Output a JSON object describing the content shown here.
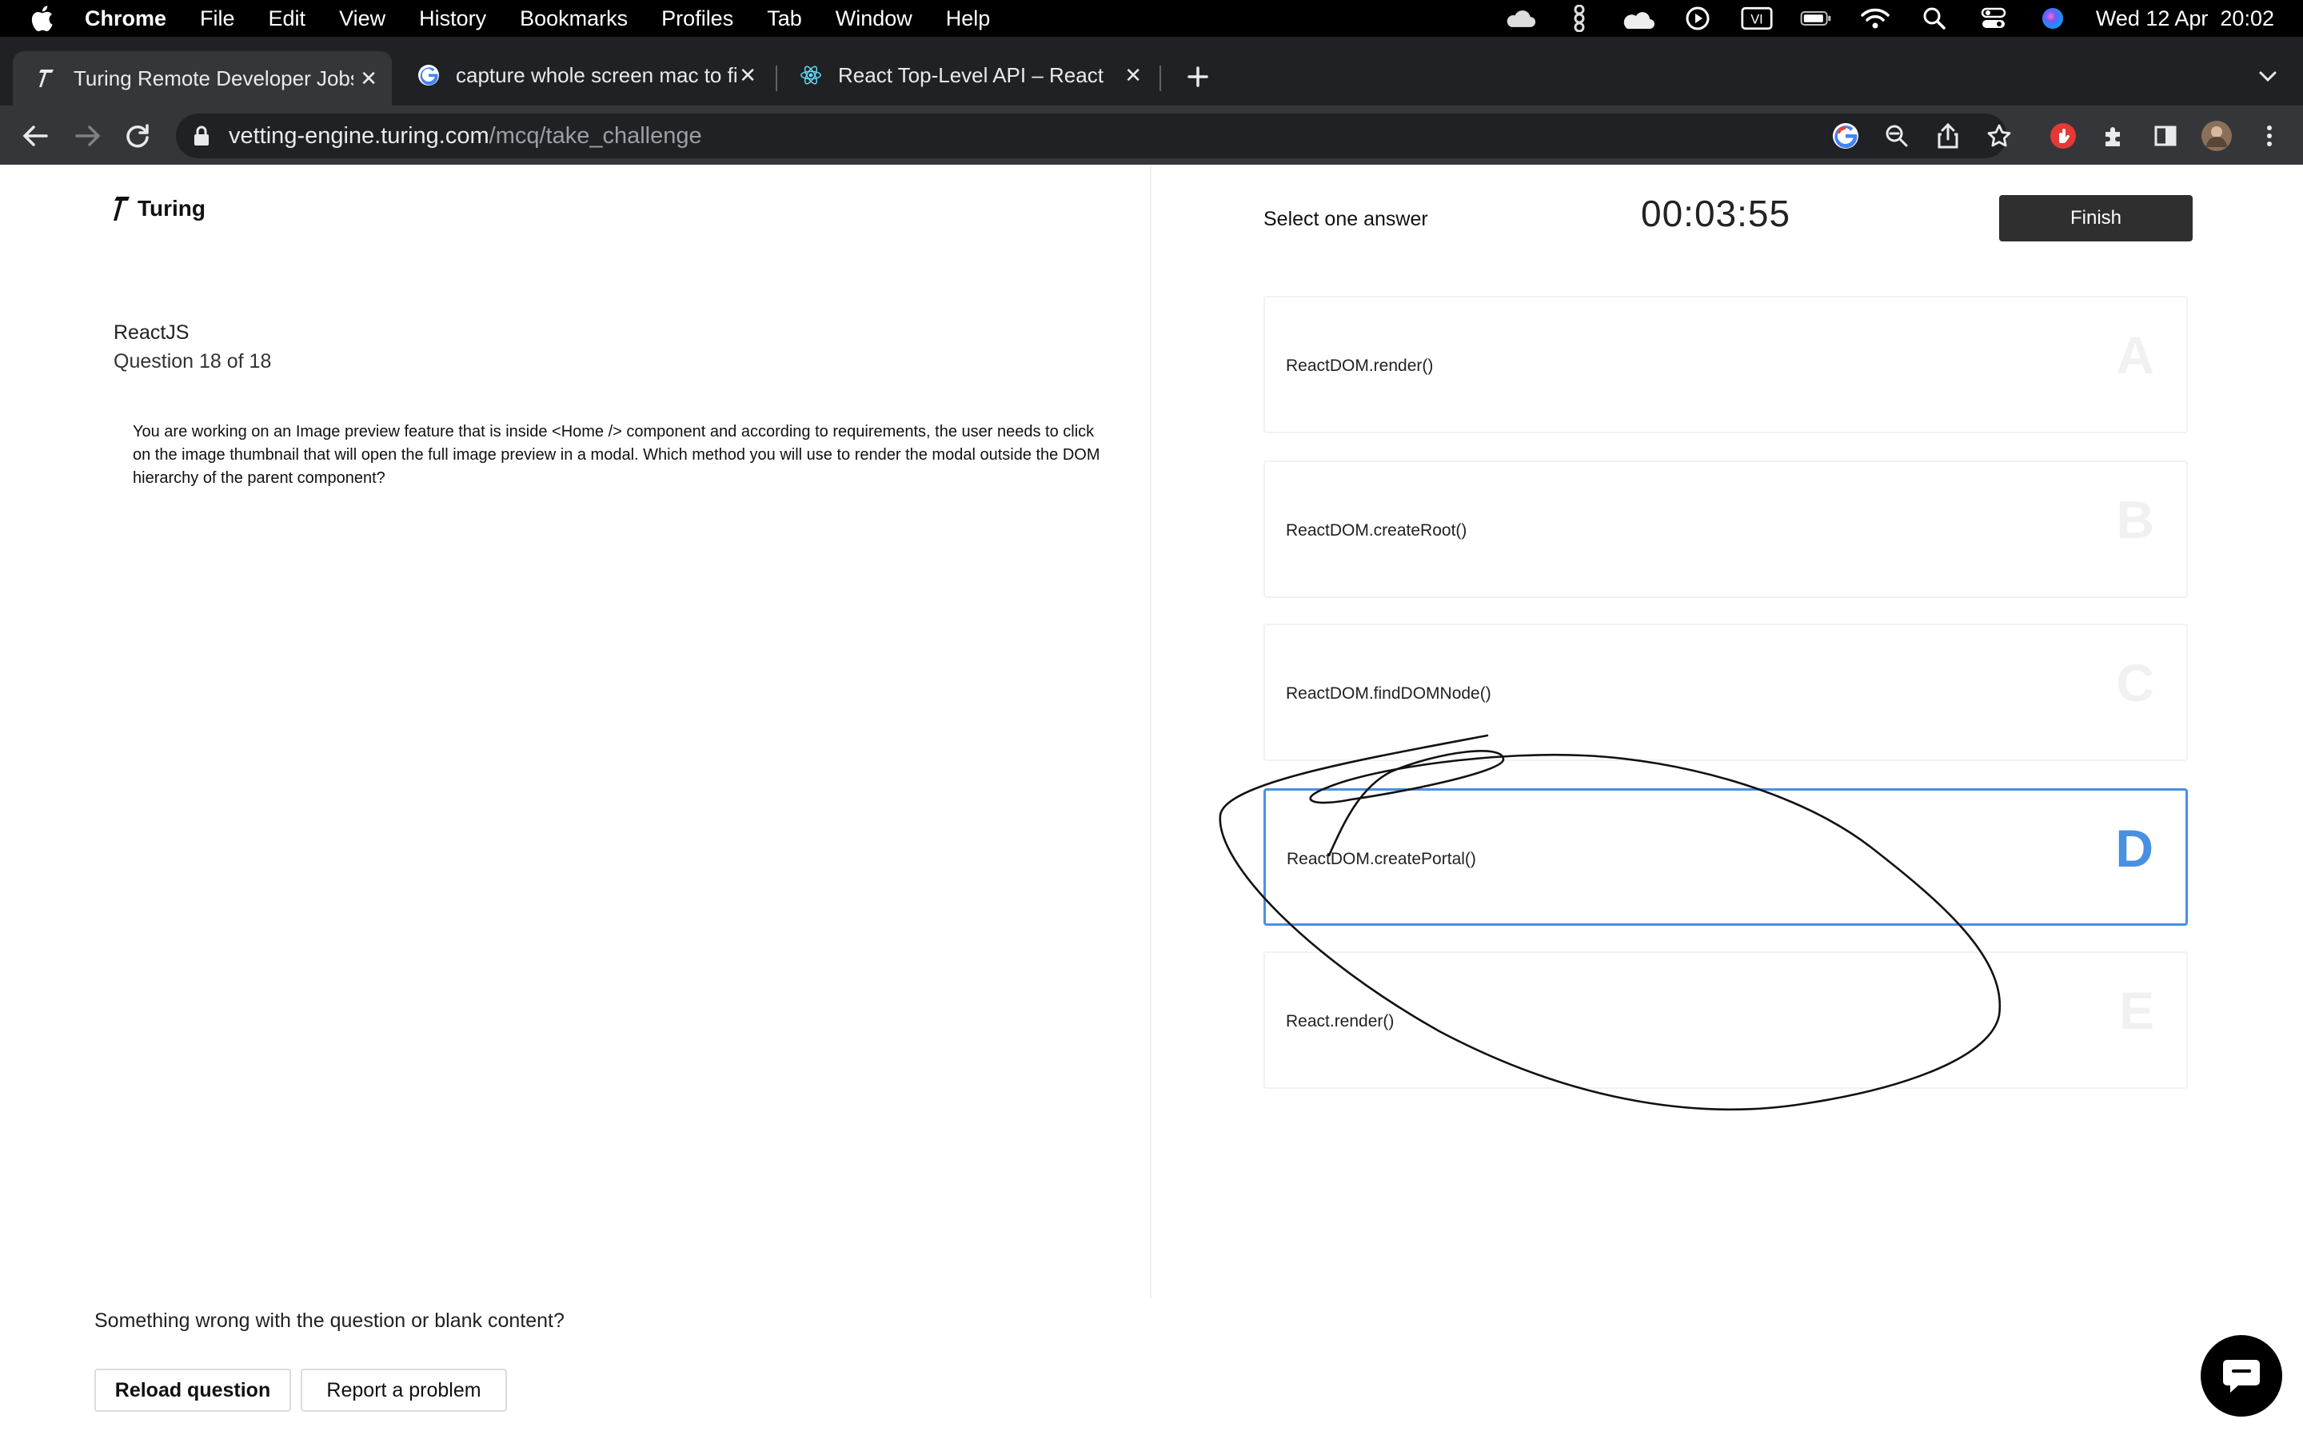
{
  "menubar": {
    "app": "Chrome",
    "items": [
      "File",
      "Edit",
      "View",
      "History",
      "Bookmarks",
      "Profiles",
      "Tab",
      "Window",
      "Help"
    ],
    "status_icons": [
      "cloud-icon",
      "figure-icon",
      "cloud-icon",
      "play-icon",
      "vi-icon",
      "battery-icon",
      "wifi-icon",
      "search-icon",
      "control-center-icon",
      "siri-icon"
    ],
    "vi_label": "VI",
    "datetime": "Wed 12 Apr  20:02"
  },
  "tabs": [
    {
      "title": "Turing Remote Developer Jobs",
      "icon": "turing-icon",
      "active": true
    },
    {
      "title": "capture whole screen mac to fi",
      "icon": "google-icon",
      "active": false
    },
    {
      "title": "React Top-Level API – React",
      "icon": "react-icon",
      "active": false
    }
  ],
  "toolbar": {
    "url_host": "vetting-engine.turing.com",
    "url_path": "/mcq/take_challenge"
  },
  "page": {
    "logo_text": "Turing",
    "subject": "ReactJS",
    "question_number": "Question 18 of 18",
    "question_text": "You are working on an Image preview feature that is inside <Home /> component and according to requirements, the user needs to click on the image thumbnail that will open the full image preview in a modal. Which method you will use to render the modal outside the DOM hierarchy of the parent component?",
    "select_label": "Select one answer",
    "timer": "00:03:55",
    "finish_label": "Finish",
    "options": [
      {
        "letter": "A",
        "text": "ReactDOM.render()",
        "selected": false
      },
      {
        "letter": "B",
        "text": "ReactDOM.createRoot()",
        "selected": false
      },
      {
        "letter": "C",
        "text": "ReactDOM.findDOMNode()",
        "selected": false
      },
      {
        "letter": "D",
        "text": "ReactDOM.createPortal()",
        "selected": true
      },
      {
        "letter": "E",
        "text": "React.render()",
        "selected": false
      }
    ],
    "report_prompt": "Something wrong with the question or blank content?",
    "reload_label": "Reload question",
    "report_label": "Report a problem"
  },
  "colors": {
    "accent": "#4a90e2",
    "finish_bg": "#2f2f2f",
    "chrome_dark": "#202124",
    "chrome_toolbar": "#35363a"
  }
}
